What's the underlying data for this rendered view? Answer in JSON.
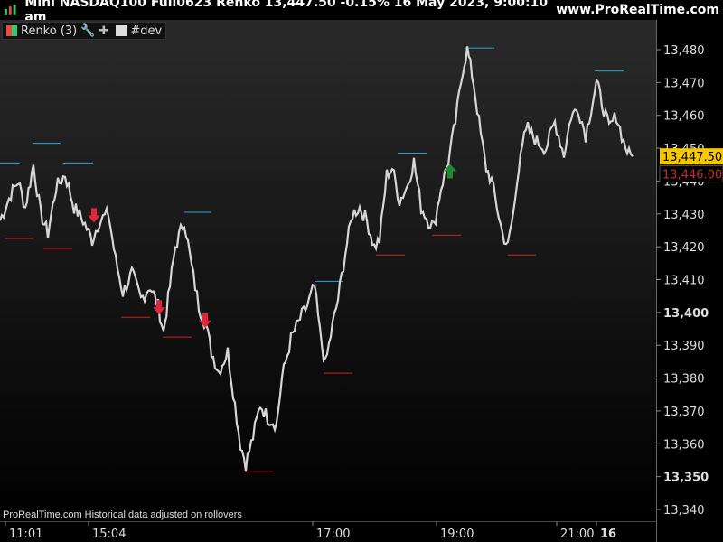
{
  "header": {
    "title": "Mini NASDAQ100 Full0623 Renko 13,447.50 -0.15% 16 May 2023, 9:00:10 am",
    "site": "www.ProRealTime.com"
  },
  "legend": {
    "indicator_label": "Renko (3)",
    "wrench_icon": "wrench-icon",
    "plus_icon": "plus-icon",
    "dev_label": "#dev"
  },
  "footnote": "ProRealTime.com  Historical data adjusted on rollovers",
  "price_tags": {
    "last": "13,447.50",
    "prev": "13,446.00"
  },
  "colors": {
    "background_top": "#2a2a2a",
    "background_bottom": "#000000",
    "price_line": "#d6d6d6",
    "resistance": "#2aa7d6",
    "support": "#d02020",
    "sell_arrow": "#e0283c",
    "buy_arrow": "#1e8a2e",
    "last_tag": "#f5c800",
    "prev_tag_text": "#c03030"
  },
  "chart_data": {
    "type": "line",
    "title": "Mini NASDAQ100 Full0623 Renko",
    "ylim": [
      13335,
      13489
    ],
    "y_ticks": [
      "13,340",
      "13,350",
      "13,360",
      "13,370",
      "13,380",
      "13,390",
      "13,400",
      "13,410",
      "13,420",
      "13,430",
      "13,440",
      "13,450",
      "13,460",
      "13,470",
      "13,480"
    ],
    "bold_ticks": [
      "13,350",
      "13,400"
    ],
    "x_ticks": [
      "11:01",
      "15:04",
      "17:00",
      "19:00",
      "21:00",
      "16"
    ],
    "path": [
      [
        0,
        13428
      ],
      [
        12,
        13436
      ],
      [
        20,
        13440
      ],
      [
        28,
        13432
      ],
      [
        37,
        13445
      ],
      [
        45,
        13430
      ],
      [
        53,
        13424
      ],
      [
        62,
        13438
      ],
      [
        72,
        13442
      ],
      [
        82,
        13432
      ],
      [
        92,
        13428
      ],
      [
        102,
        13422
      ],
      [
        110,
        13428
      ],
      [
        120,
        13430
      ],
      [
        128,
        13416
      ],
      [
        136,
        13406
      ],
      [
        146,
        13412
      ],
      [
        156,
        13404
      ],
      [
        166,
        13408
      ],
      [
        175,
        13402
      ],
      [
        181,
        13394
      ],
      [
        186,
        13404
      ],
      [
        194,
        13420
      ],
      [
        204,
        13428
      ],
      [
        212,
        13414
      ],
      [
        220,
        13402
      ],
      [
        228,
        13396
      ],
      [
        234,
        13388
      ],
      [
        242,
        13382
      ],
      [
        252,
        13388
      ],
      [
        260,
        13372
      ],
      [
        266,
        13360
      ],
      [
        272,
        13354
      ],
      [
        280,
        13362
      ],
      [
        288,
        13372
      ],
      [
        296,
        13368
      ],
      [
        306,
        13366
      ],
      [
        312,
        13380
      ],
      [
        322,
        13392
      ],
      [
        332,
        13398
      ],
      [
        340,
        13402
      ],
      [
        348,
        13408
      ],
      [
        354,
        13394
      ],
      [
        360,
        13384
      ],
      [
        368,
        13396
      ],
      [
        374,
        13404
      ],
      [
        382,
        13418
      ],
      [
        390,
        13430
      ],
      [
        398,
        13432
      ],
      [
        406,
        13428
      ],
      [
        414,
        13420
      ],
      [
        420,
        13422
      ],
      [
        428,
        13442
      ],
      [
        434,
        13444
      ],
      [
        442,
        13434
      ],
      [
        450,
        13438
      ],
      [
        458,
        13446
      ],
      [
        466,
        13432
      ],
      [
        474,
        13428
      ],
      [
        480,
        13426
      ],
      [
        488,
        13438
      ],
      [
        496,
        13446
      ],
      [
        504,
        13458
      ],
      [
        512,
        13474
      ],
      [
        517,
        13480
      ],
      [
        524,
        13470
      ],
      [
        532,
        13454
      ],
      [
        538,
        13444
      ],
      [
        544,
        13440
      ],
      [
        550,
        13432
      ],
      [
        556,
        13424
      ],
      [
        562,
        13420
      ],
      [
        570,
        13434
      ],
      [
        576,
        13450
      ],
      [
        584,
        13456
      ],
      [
        594,
        13452
      ],
      [
        604,
        13450
      ],
      [
        614,
        13458
      ],
      [
        624,
        13448
      ],
      [
        632,
        13460
      ],
      [
        640,
        13462
      ],
      [
        648,
        13454
      ],
      [
        654,
        13462
      ],
      [
        660,
        13470
      ],
      [
        666,
        13464
      ],
      [
        674,
        13456
      ],
      [
        682,
        13460
      ],
      [
        690,
        13452
      ],
      [
        696,
        13448
      ],
      [
        700,
        13447.5
      ]
    ],
    "resistance_levels": [
      {
        "x0": 0,
        "x1": 22,
        "y": 13445.5
      },
      {
        "x0": 36,
        "x1": 67,
        "y": 13451.5
      },
      {
        "x0": 70,
        "x1": 103,
        "y": 13445.5
      },
      {
        "x0": 204,
        "x1": 234,
        "y": 13430.5
      },
      {
        "x0": 348,
        "x1": 380,
        "y": 13409.5
      },
      {
        "x0": 440,
        "x1": 472,
        "y": 13448.5
      },
      {
        "x0": 514,
        "x1": 547,
        "y": 13480.5
      },
      {
        "x0": 658,
        "x1": 690,
        "y": 13473.5
      }
    ],
    "support_levels": [
      {
        "x0": 5,
        "x1": 37,
        "y": 13422.5
      },
      {
        "x0": 48,
        "x1": 80,
        "y": 13419.5
      },
      {
        "x0": 134,
        "x1": 166,
        "y": 13398.5
      },
      {
        "x0": 180,
        "x1": 212,
        "y": 13392.5
      },
      {
        "x0": 270,
        "x1": 302,
        "y": 13351.5
      },
      {
        "x0": 358,
        "x1": 390,
        "y": 13381.5
      },
      {
        "x0": 416,
        "x1": 448,
        "y": 13417.5
      },
      {
        "x0": 478,
        "x1": 510,
        "y": 13423.5
      },
      {
        "x0": 562,
        "x1": 593,
        "y": 13417.5
      }
    ],
    "sell_arrows": [
      {
        "x": 104,
        "y": 13429
      },
      {
        "x": 176,
        "y": 13401
      },
      {
        "x": 227,
        "y": 13397
      }
    ],
    "buy_arrows": [
      {
        "x": 498,
        "y": 13443
      }
    ]
  }
}
